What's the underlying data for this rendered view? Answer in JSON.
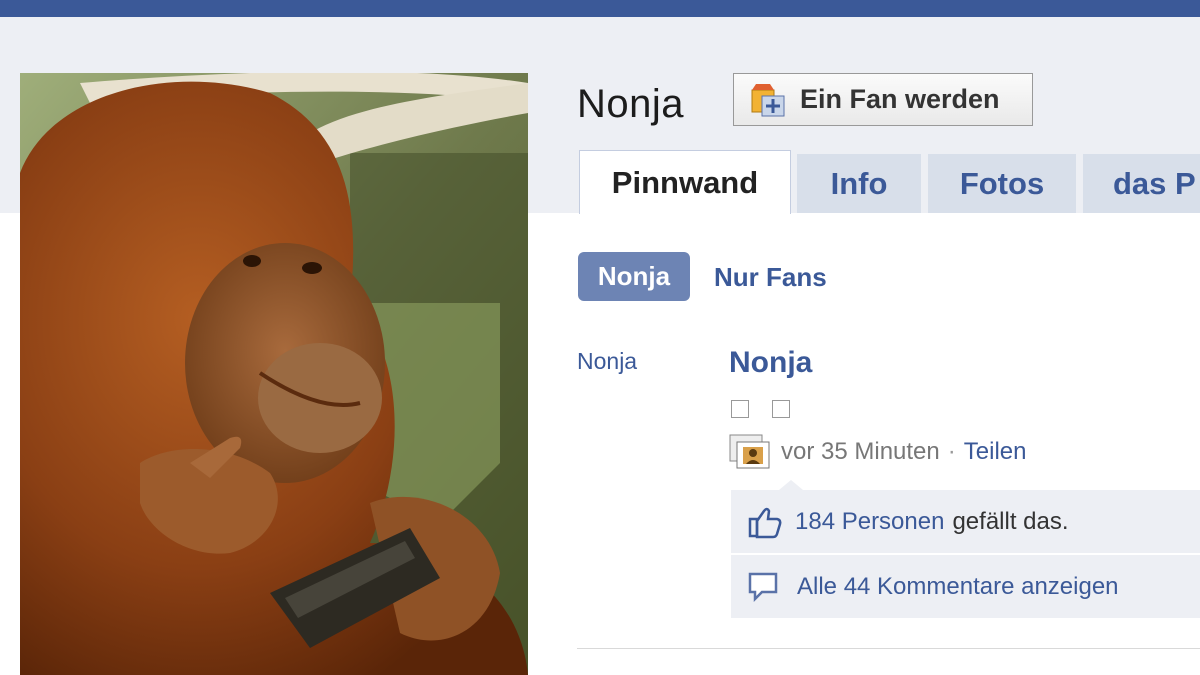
{
  "page": {
    "name": "Nonja",
    "fan_button_label": "Ein Fan werden"
  },
  "tabs": [
    {
      "label": "Pinnwand",
      "active": true
    },
    {
      "label": "Info",
      "active": false
    },
    {
      "label": "Fotos",
      "active": false
    },
    {
      "label": "das P",
      "active": false
    }
  ],
  "filters": {
    "page_filter": "Nonja",
    "fans_filter": "Nur Fans"
  },
  "story": {
    "actor": "Nonja",
    "title": "Nonja",
    "time": "vor 35 Minuten",
    "separator": "·",
    "share_label": "Teilen",
    "likes_link": "184 Personen",
    "likes_suffix": "gefällt das.",
    "comments_link": "Alle 44 Kommentare anzeigen"
  },
  "icons": [
    "fan-badge-icon",
    "photo-icon",
    "thumbs-up-icon",
    "comment-bubble-icon"
  ],
  "colors": {
    "brand": "#3b5998",
    "tab_inactive": "#d8dfea",
    "pill": "#6d84b4",
    "feedback_bg": "#edeff4"
  }
}
